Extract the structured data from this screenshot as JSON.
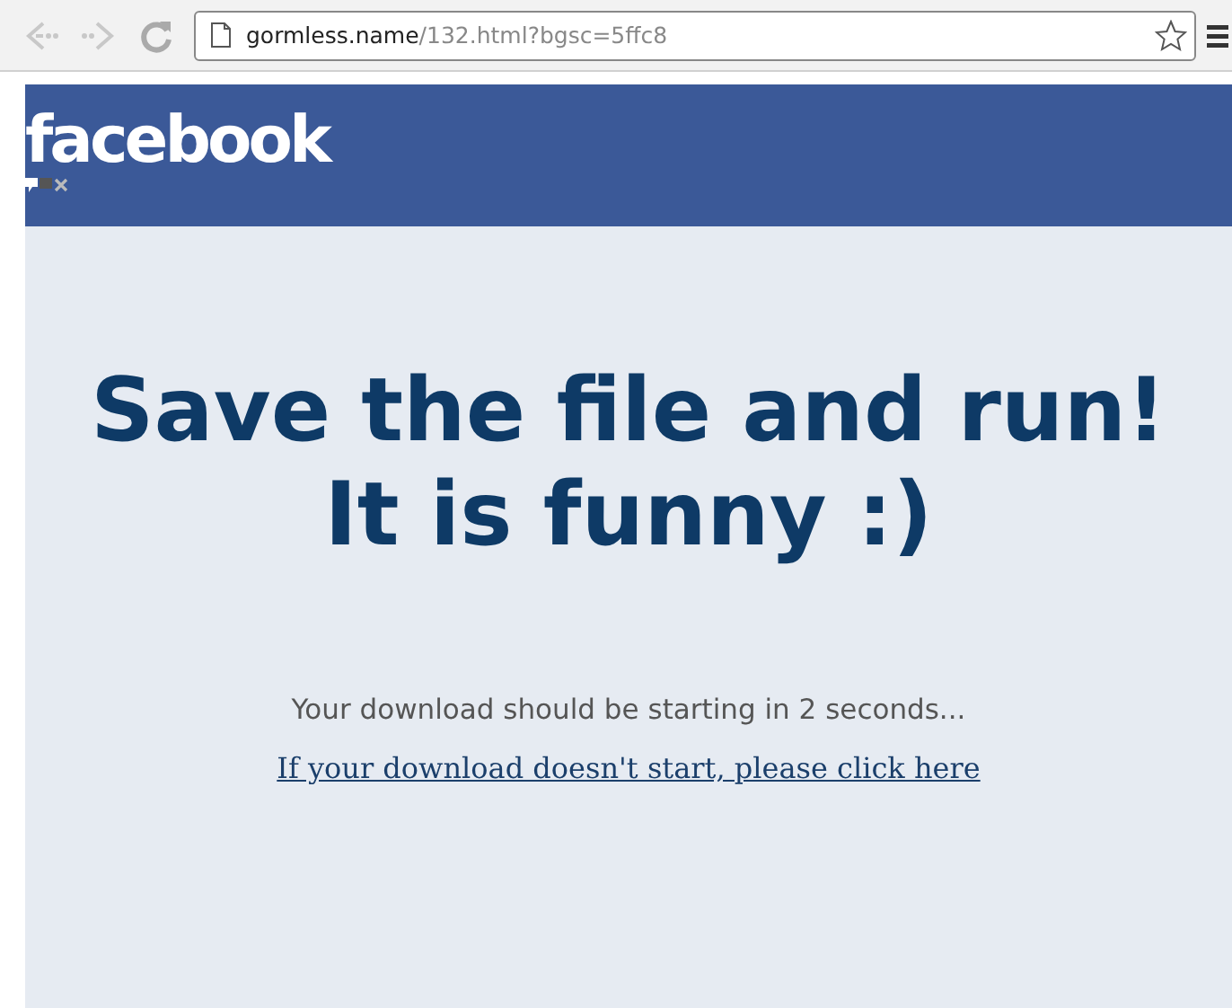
{
  "browser": {
    "address_domain": "gormless.name",
    "address_path": "/132.html?bgsc=5ffc8"
  },
  "page": {
    "logo": "facebook",
    "heading": "Save the file and run! It is funny :)",
    "status": "Your download should be starting in 2 seconds...",
    "link": "If your download doesn't start, please click here"
  }
}
